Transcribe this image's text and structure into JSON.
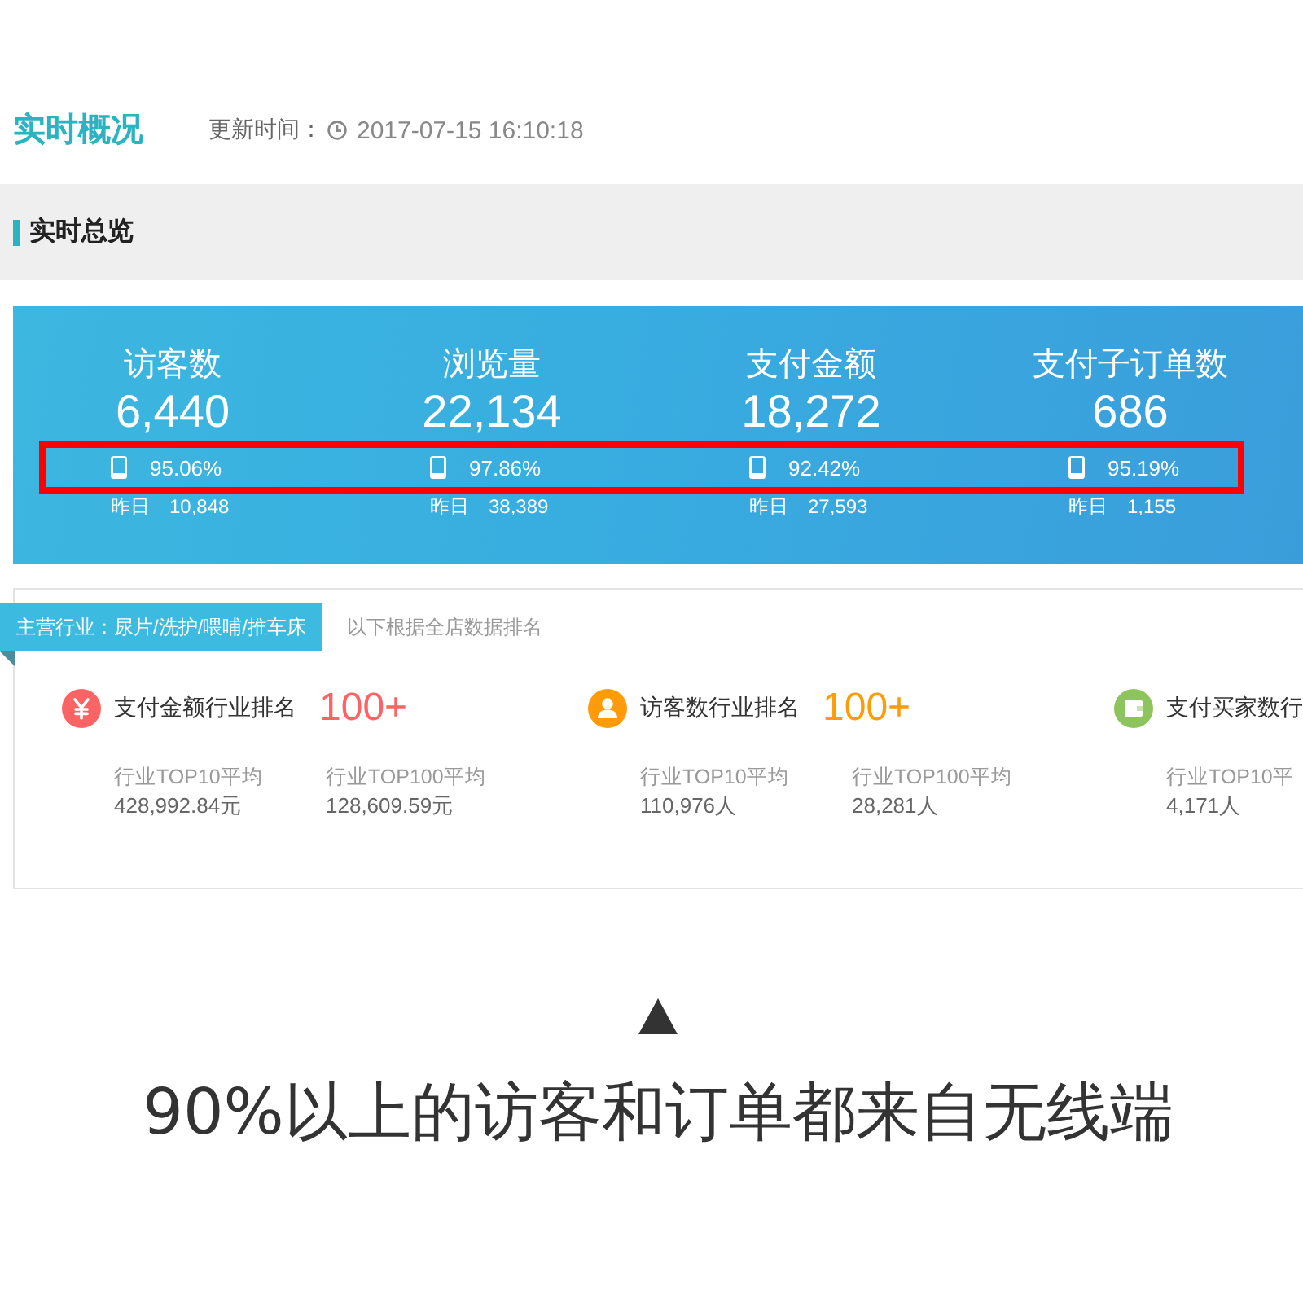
{
  "header": {
    "title": "实时概况",
    "update_label": "更新时间：",
    "update_time": "2017-07-15 16:10:18"
  },
  "section": {
    "title": "实时总览"
  },
  "metrics": [
    {
      "label": "访客数",
      "value": "6,440",
      "mobile_share": "95.06%",
      "yesterday_label": "昨日",
      "yesterday_value": "10,848"
    },
    {
      "label": "浏览量",
      "value": "22,134",
      "mobile_share": "97.86%",
      "yesterday_label": "昨日",
      "yesterday_value": "38,389"
    },
    {
      "label": "支付金额",
      "value": "18,272",
      "mobile_share": "92.42%",
      "yesterday_label": "昨日",
      "yesterday_value": "27,593"
    },
    {
      "label": "支付子订单数",
      "value": "686",
      "mobile_share": "95.19%",
      "yesterday_label": "昨日",
      "yesterday_value": "1,155"
    }
  ],
  "ranking": {
    "industry_tag": "主营行业：尿片/洗护/喂哺/推车床",
    "note": "以下根据全店数据排名",
    "items": [
      {
        "kind": "payment",
        "title": "支付金额行业排名",
        "rank": "100+",
        "color": "#fb6464",
        "stats": [
          {
            "label": "行业TOP10平均",
            "value": "428,992.84元"
          },
          {
            "label": "行业TOP100平均",
            "value": "128,609.59元"
          }
        ]
      },
      {
        "kind": "visitors",
        "title": "访客数行业排名",
        "rank": "100+",
        "color": "#fd9c07",
        "stats": [
          {
            "label": "行业TOP10平均",
            "value": "110,976人"
          },
          {
            "label": "行业TOP100平均",
            "value": "28,281人"
          }
        ]
      },
      {
        "kind": "buyers",
        "title": "支付买家数行",
        "color": "#8dc55c",
        "stats": [
          {
            "label": "行业TOP10平",
            "value": "4,171人"
          }
        ]
      }
    ]
  },
  "caption": "90%以上的访客和订单都来自无线端"
}
